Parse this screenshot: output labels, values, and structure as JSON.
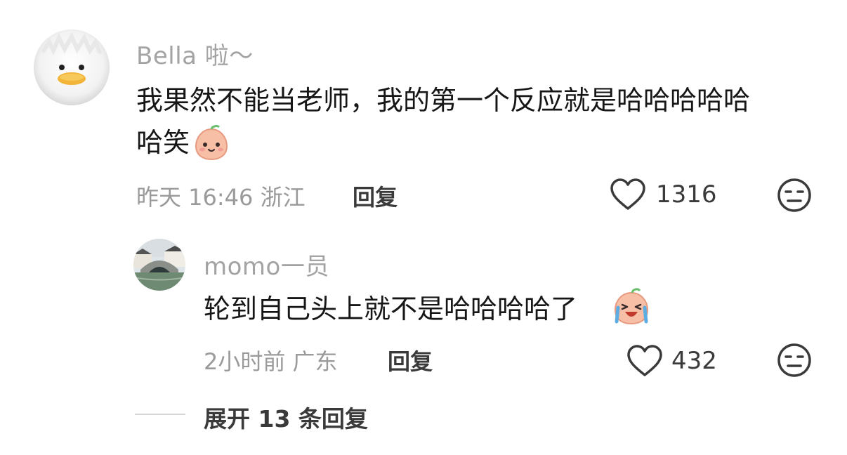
{
  "comment": {
    "username": "Bella 啦～",
    "text_line1": "我果然不能当老师，我的第一个反应就是哈哈哈哈哈",
    "text_line2": "哈笑",
    "meta": "昨天 16:46 浙江",
    "reply_label": "回复",
    "like_count": "1316",
    "emoji": "smile-sticker"
  },
  "reply": {
    "username": "momo一员",
    "text": "轮到自己头上就不是哈哈哈哈了",
    "meta": "2小时前 广东",
    "reply_label": "回复",
    "like_count": "432",
    "emoji": "crying-laughing-sticker"
  },
  "expand_label": "展开 13 条回复",
  "colors": {
    "sticker_skin": "#f6bfa6",
    "sticker_leaf": "#6bbf6f",
    "heart_stroke": "#3a3a3a"
  }
}
